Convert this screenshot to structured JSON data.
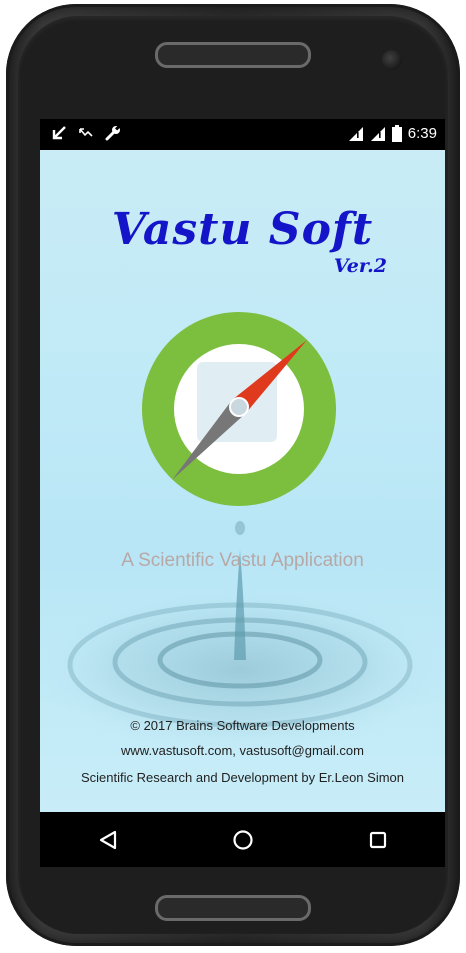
{
  "status_bar": {
    "time": "6:39",
    "left_icons": [
      "download-arrow-icon",
      "missed-call-icon",
      "wrench-icon"
    ],
    "right_icons": [
      "signal-icon",
      "signal-icon",
      "battery-icon"
    ]
  },
  "app": {
    "title": "Vastu Soft",
    "version": "Ver.2",
    "tagline": "A Scientific Vastu Application",
    "footer": {
      "copyright": "© 2017 Brains Software Developments",
      "contact": "www.vastusoft.com, vastusoft@gmail.com",
      "credit": "Scientific Research and Development by Er.Leon Simon"
    },
    "colors": {
      "title": "#1414c8",
      "compass_ring": "#7cbf3f",
      "needle_north": "#e03a1e",
      "needle_south": "#777777",
      "background": "#bfe9f7"
    }
  },
  "nav_bar": {
    "buttons": [
      "back-icon",
      "home-icon",
      "recents-icon"
    ]
  }
}
